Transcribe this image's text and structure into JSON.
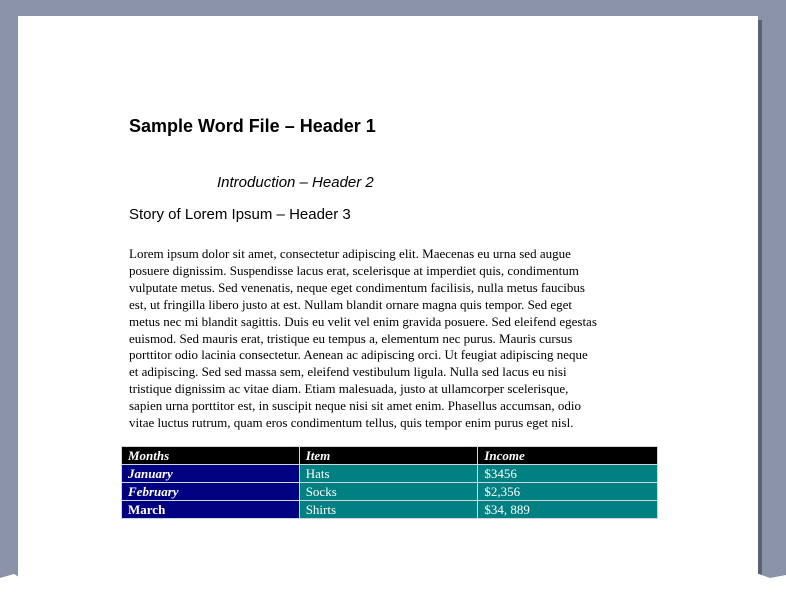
{
  "document": {
    "header1": "Sample Word File – Header 1",
    "header2": "Introduction – Header 2",
    "header3": "Story of Lorem Ipsum – Header 3",
    "paragraph_lines": [
      "Lorem ipsum dolor sit amet, consectetur adipiscing elit. Maecenas eu urna sed augue",
      "posuere dignissim. Suspendisse lacus erat, scelerisque at imperdiet quis, condimentum",
      "vulputate metus. Sed venenatis, neque eget condimentum facilisis, nulla metus faucibus",
      "est, ut fringilla libero justo at est. Nullam blandit ornare magna quis tempor. Sed eget",
      "metus nec mi blandit sagittis. Duis eu velit vel enim gravida posuere. Sed eleifend egestas",
      "euismod. Sed mauris erat, tristique eu tempus a, elementum nec purus. Mauris cursus",
      "porttitor odio lacinia consectetur. Aenean ac adipiscing orci. Ut feugiat adipiscing neque",
      "et adipiscing. Sed sed massa sem, eleifend vestibulum ligula. Nulla sed lacus eu nisi",
      "tristique dignissim ac vitae diam. Etiam malesuada, justo at ullamcorper scelerisque,",
      "sapien urna porttitor est, in suscipit neque nisi sit amet enim. Phasellus accumsan, odio",
      "vitae luctus rutrum, quam eros condimentum tellus, quis tempor enim purus eget nisl."
    ]
  },
  "table": {
    "headers": [
      "Months",
      "Item",
      "Income"
    ],
    "rows": [
      {
        "month": "January",
        "item": "Hats",
        "income": "$3456"
      },
      {
        "month": "February",
        "item": "Socks",
        "income": "$2,356"
      },
      {
        "month": "March",
        "item": "Shirts",
        "income": "$34, 889"
      }
    ]
  },
  "colors": {
    "frame": "#8a93a8",
    "header_row": "#000000",
    "month_column": "#000080",
    "data_cells": "#008080",
    "spellcheck_underline": "#e23b3b"
  }
}
